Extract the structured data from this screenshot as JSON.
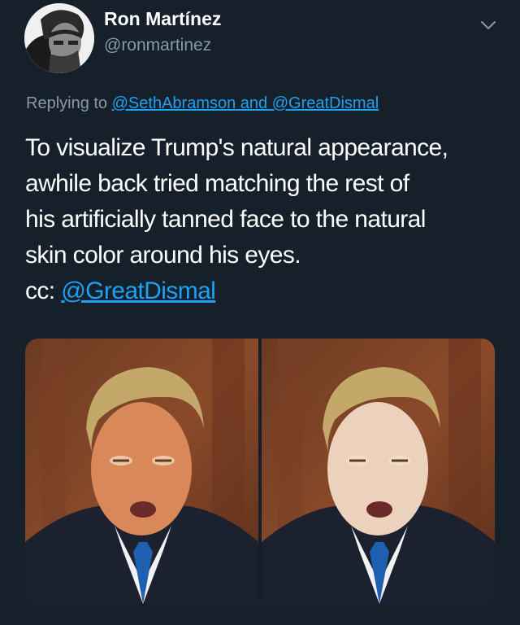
{
  "author": {
    "display_name": "Ron Martínez",
    "handle": "@ronmartinez",
    "avatar_icon": "person-avatar-icon"
  },
  "reply": {
    "prefix": "Replying to ",
    "mention1": "@SethAbramson",
    "and_text": " and ",
    "mention2": "@GreatDismal"
  },
  "tweet": {
    "lines": [
      "To visualize Trump's natural appearance,",
      "awhile back tried matching the rest of",
      "his artificially tanned face to the natural",
      "skin color around his eyes."
    ],
    "cc_prefix": "cc: ",
    "cc_mention": "@GreatDismal"
  },
  "menu_icon": "chevron-down-icon",
  "colors": {
    "background": "#15202b",
    "link": "#1da1f2",
    "secondary_text": "#8899a6"
  }
}
